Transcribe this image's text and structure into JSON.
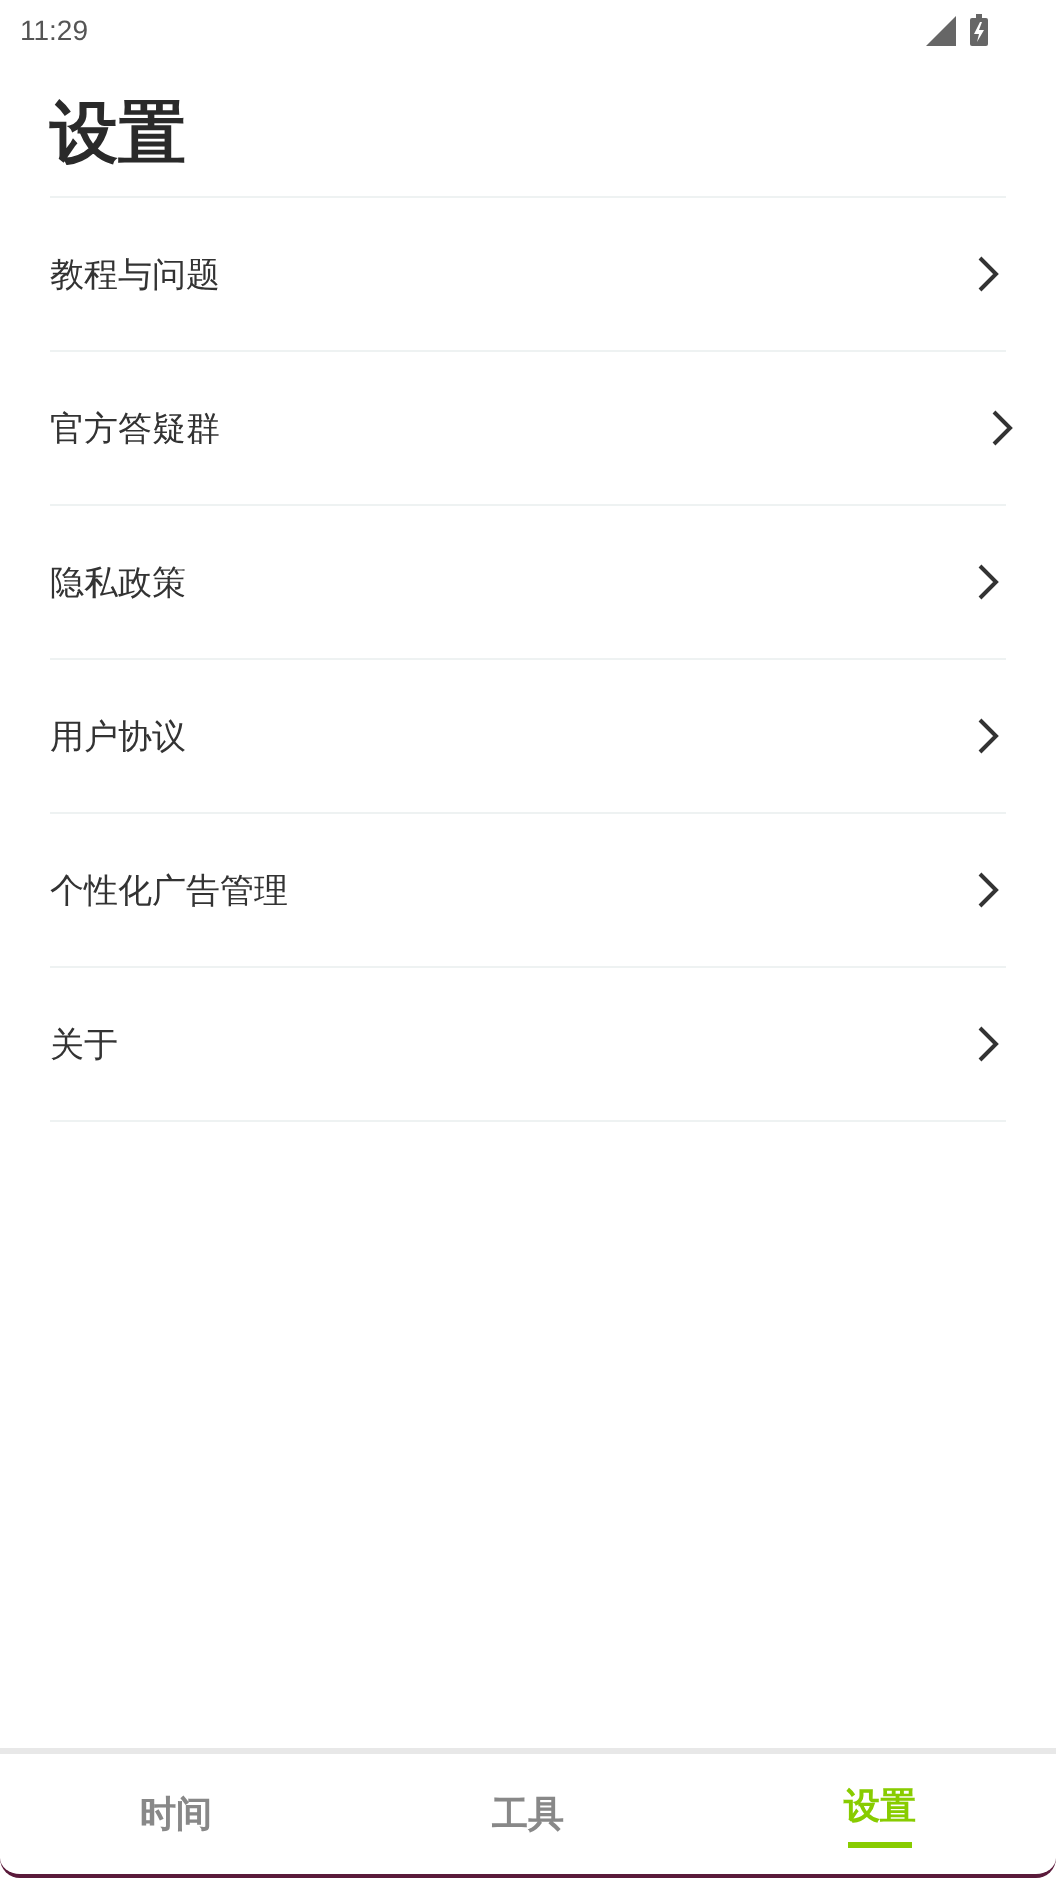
{
  "status_bar": {
    "time": "11:29"
  },
  "title": "设置",
  "items": [
    {
      "label": "教程与问题"
    },
    {
      "label": "官方答疑群"
    },
    {
      "label": "隐私政策"
    },
    {
      "label": "用户协议"
    },
    {
      "label": "个性化广告管理"
    },
    {
      "label": "关于"
    }
  ],
  "tabs": [
    {
      "label": "时间",
      "selected": false
    },
    {
      "label": "工具",
      "selected": false
    },
    {
      "label": "设置",
      "selected": true
    }
  ]
}
